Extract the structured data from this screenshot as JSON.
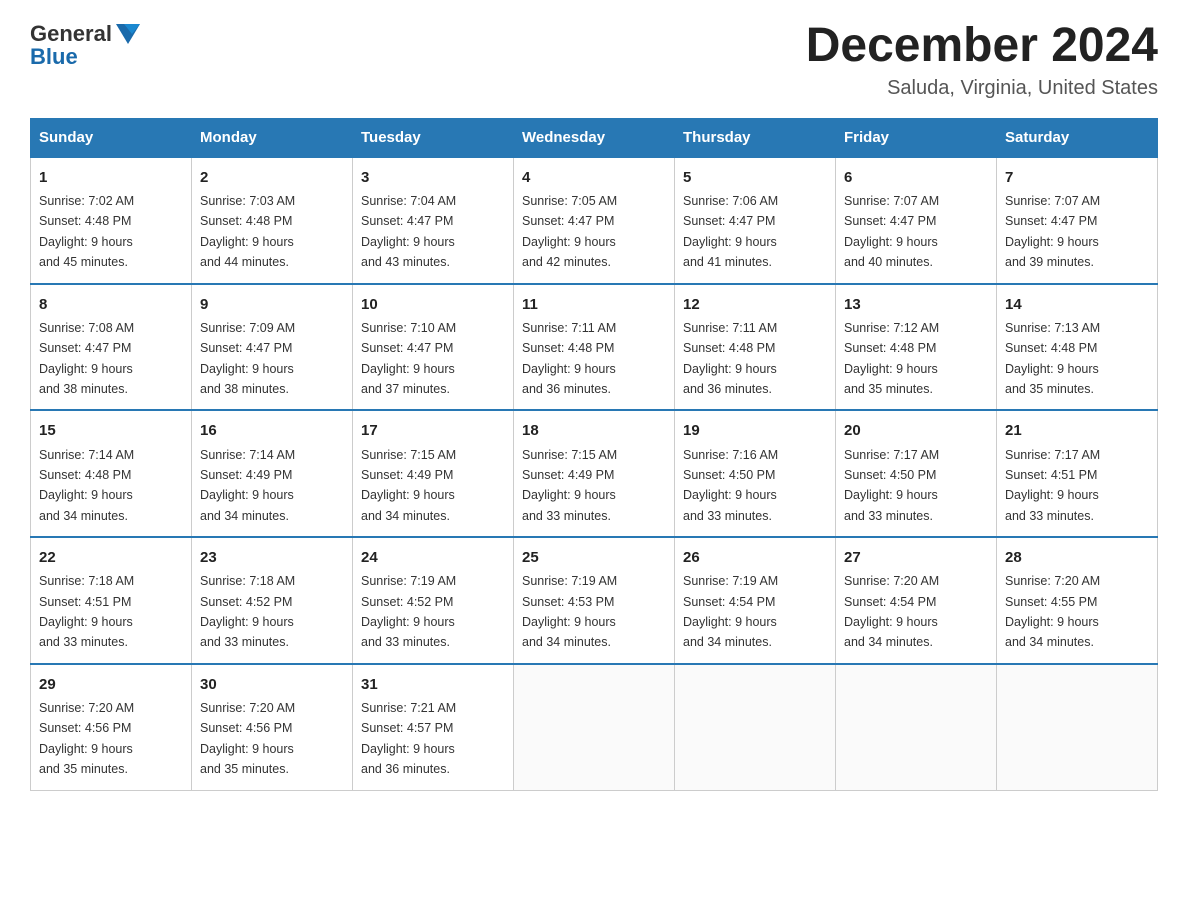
{
  "logo": {
    "text_general": "General",
    "text_blue": "Blue",
    "aria": "GeneralBlue logo"
  },
  "title": "December 2024",
  "location": "Saluda, Virginia, United States",
  "days_of_week": [
    "Sunday",
    "Monday",
    "Tuesday",
    "Wednesday",
    "Thursday",
    "Friday",
    "Saturday"
  ],
  "weeks": [
    [
      {
        "day": "1",
        "sunrise": "7:02 AM",
        "sunset": "4:48 PM",
        "daylight": "9 hours and 45 minutes."
      },
      {
        "day": "2",
        "sunrise": "7:03 AM",
        "sunset": "4:48 PM",
        "daylight": "9 hours and 44 minutes."
      },
      {
        "day": "3",
        "sunrise": "7:04 AM",
        "sunset": "4:47 PM",
        "daylight": "9 hours and 43 minutes."
      },
      {
        "day": "4",
        "sunrise": "7:05 AM",
        "sunset": "4:47 PM",
        "daylight": "9 hours and 42 minutes."
      },
      {
        "day": "5",
        "sunrise": "7:06 AM",
        "sunset": "4:47 PM",
        "daylight": "9 hours and 41 minutes."
      },
      {
        "day": "6",
        "sunrise": "7:07 AM",
        "sunset": "4:47 PM",
        "daylight": "9 hours and 40 minutes."
      },
      {
        "day": "7",
        "sunrise": "7:07 AM",
        "sunset": "4:47 PM",
        "daylight": "9 hours and 39 minutes."
      }
    ],
    [
      {
        "day": "8",
        "sunrise": "7:08 AM",
        "sunset": "4:47 PM",
        "daylight": "9 hours and 38 minutes."
      },
      {
        "day": "9",
        "sunrise": "7:09 AM",
        "sunset": "4:47 PM",
        "daylight": "9 hours and 38 minutes."
      },
      {
        "day": "10",
        "sunrise": "7:10 AM",
        "sunset": "4:47 PM",
        "daylight": "9 hours and 37 minutes."
      },
      {
        "day": "11",
        "sunrise": "7:11 AM",
        "sunset": "4:48 PM",
        "daylight": "9 hours and 36 minutes."
      },
      {
        "day": "12",
        "sunrise": "7:11 AM",
        "sunset": "4:48 PM",
        "daylight": "9 hours and 36 minutes."
      },
      {
        "day": "13",
        "sunrise": "7:12 AM",
        "sunset": "4:48 PM",
        "daylight": "9 hours and 35 minutes."
      },
      {
        "day": "14",
        "sunrise": "7:13 AM",
        "sunset": "4:48 PM",
        "daylight": "9 hours and 35 minutes."
      }
    ],
    [
      {
        "day": "15",
        "sunrise": "7:14 AM",
        "sunset": "4:48 PM",
        "daylight": "9 hours and 34 minutes."
      },
      {
        "day": "16",
        "sunrise": "7:14 AM",
        "sunset": "4:49 PM",
        "daylight": "9 hours and 34 minutes."
      },
      {
        "day": "17",
        "sunrise": "7:15 AM",
        "sunset": "4:49 PM",
        "daylight": "9 hours and 34 minutes."
      },
      {
        "day": "18",
        "sunrise": "7:15 AM",
        "sunset": "4:49 PM",
        "daylight": "9 hours and 33 minutes."
      },
      {
        "day": "19",
        "sunrise": "7:16 AM",
        "sunset": "4:50 PM",
        "daylight": "9 hours and 33 minutes."
      },
      {
        "day": "20",
        "sunrise": "7:17 AM",
        "sunset": "4:50 PM",
        "daylight": "9 hours and 33 minutes."
      },
      {
        "day": "21",
        "sunrise": "7:17 AM",
        "sunset": "4:51 PM",
        "daylight": "9 hours and 33 minutes."
      }
    ],
    [
      {
        "day": "22",
        "sunrise": "7:18 AM",
        "sunset": "4:51 PM",
        "daylight": "9 hours and 33 minutes."
      },
      {
        "day": "23",
        "sunrise": "7:18 AM",
        "sunset": "4:52 PM",
        "daylight": "9 hours and 33 minutes."
      },
      {
        "day": "24",
        "sunrise": "7:19 AM",
        "sunset": "4:52 PM",
        "daylight": "9 hours and 33 minutes."
      },
      {
        "day": "25",
        "sunrise": "7:19 AM",
        "sunset": "4:53 PM",
        "daylight": "9 hours and 34 minutes."
      },
      {
        "day": "26",
        "sunrise": "7:19 AM",
        "sunset": "4:54 PM",
        "daylight": "9 hours and 34 minutes."
      },
      {
        "day": "27",
        "sunrise": "7:20 AM",
        "sunset": "4:54 PM",
        "daylight": "9 hours and 34 minutes."
      },
      {
        "day": "28",
        "sunrise": "7:20 AM",
        "sunset": "4:55 PM",
        "daylight": "9 hours and 34 minutes."
      }
    ],
    [
      {
        "day": "29",
        "sunrise": "7:20 AM",
        "sunset": "4:56 PM",
        "daylight": "9 hours and 35 minutes."
      },
      {
        "day": "30",
        "sunrise": "7:20 AM",
        "sunset": "4:56 PM",
        "daylight": "9 hours and 35 minutes."
      },
      {
        "day": "31",
        "sunrise": "7:21 AM",
        "sunset": "4:57 PM",
        "daylight": "9 hours and 36 minutes."
      },
      null,
      null,
      null,
      null
    ]
  ],
  "labels": {
    "sunrise": "Sunrise:",
    "sunset": "Sunset:",
    "daylight": "Daylight:"
  }
}
